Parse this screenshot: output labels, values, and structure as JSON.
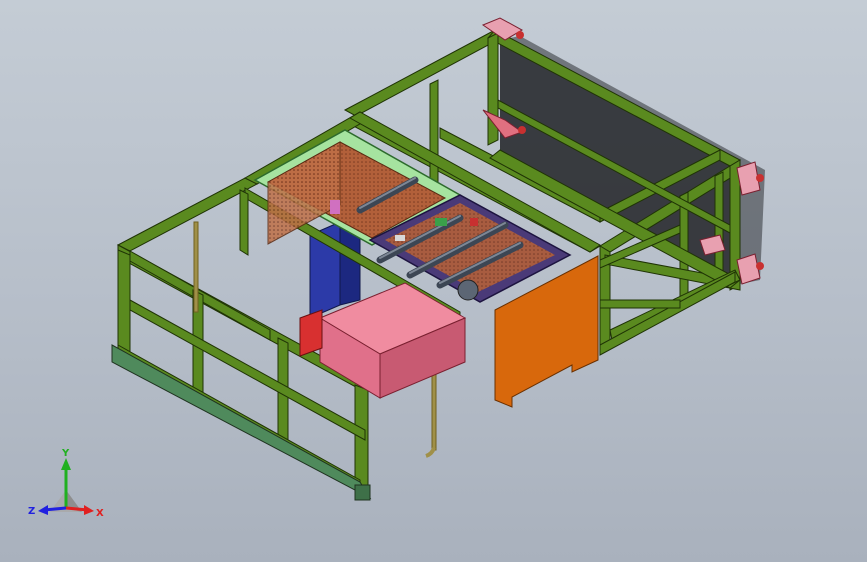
{
  "viewport": {
    "background_top": "#c4ccd5",
    "background_bottom": "#a9b1bd"
  },
  "model": {
    "frame_color": "#5a8a1f",
    "frame_edge": "#1f3305",
    "base_skid_color": "#4f8a5c",
    "tray_rim_color": "#a6e3a0",
    "copper_mesh_color": "#b2603a",
    "purple_panel_color": "#4a3a78",
    "pink_box_color": "#e0708a",
    "orange_panel_color": "#d8680c",
    "blue_block_color": "#2c3aa8",
    "red_bracket_color": "#c83030",
    "pink_bracket_color": "#e8a0b0",
    "tube_color": "#a09048"
  },
  "triad": {
    "x_label": "X",
    "y_label": "Y",
    "z_label": "Z",
    "x_color": "#e02020",
    "y_color": "#20b020",
    "z_color": "#2020e0"
  }
}
